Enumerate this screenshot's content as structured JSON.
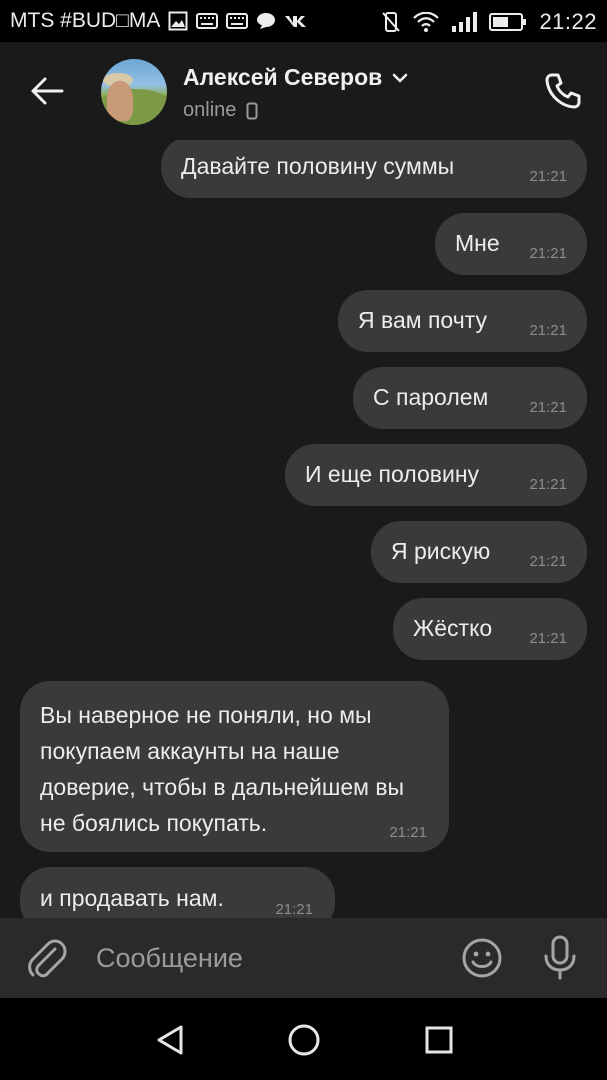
{
  "status_bar": {
    "carrier": "MTS #BUD□MA",
    "time": "21:22",
    "icons": [
      "image-icon",
      "keyboard-icon",
      "keyboard-icon",
      "chat-bubble-icon",
      "vk-icon",
      "vibrate-off-icon",
      "wifi-icon",
      "signal-icon",
      "battery-icon"
    ]
  },
  "header": {
    "back_icon": "arrow-left-icon",
    "contact_name": "Алексей Северов",
    "status": "online",
    "status_icon": "mobile-phone-icon",
    "dropdown_icon": "chevron-down-icon",
    "call_icon": "phone-icon"
  },
  "messages": [
    {
      "text": "Давайте половину суммы",
      "time": "21:21",
      "outgoing": true
    },
    {
      "text": "Мне",
      "time": "21:21",
      "outgoing": true
    },
    {
      "text": "Я вам почту",
      "time": "21:21",
      "outgoing": true
    },
    {
      "text": "С паролем",
      "time": "21:21",
      "outgoing": true
    },
    {
      "text": "И еще половину",
      "time": "21:21",
      "outgoing": true
    },
    {
      "text": "Я рискую",
      "time": "21:21",
      "outgoing": true
    },
    {
      "text": "Жёстко",
      "time": "21:21",
      "outgoing": true
    },
    {
      "text": "Вы наверное не поняли, но мы покупаем аккаунты на наше доверие, чтобы в дальнейшем вы не боялись покупать.",
      "time": "21:21",
      "outgoing": false
    },
    {
      "text": "и продавать нам.",
      "time": "21:21",
      "outgoing": false
    }
  ],
  "composer": {
    "placeholder": "Сообщение",
    "attach_icon": "paperclip-icon",
    "emoji_icon": "smile-icon",
    "mic_icon": "microphone-icon"
  },
  "navbar": {
    "icons": [
      "back-triangle-icon",
      "home-circle-icon",
      "recents-square-icon"
    ]
  },
  "colors": {
    "background": "#1a1a1a",
    "bubble": "#3a3a3a",
    "composer": "#2a2a2a",
    "text": "#ececec",
    "muted": "#8c8c8c"
  }
}
